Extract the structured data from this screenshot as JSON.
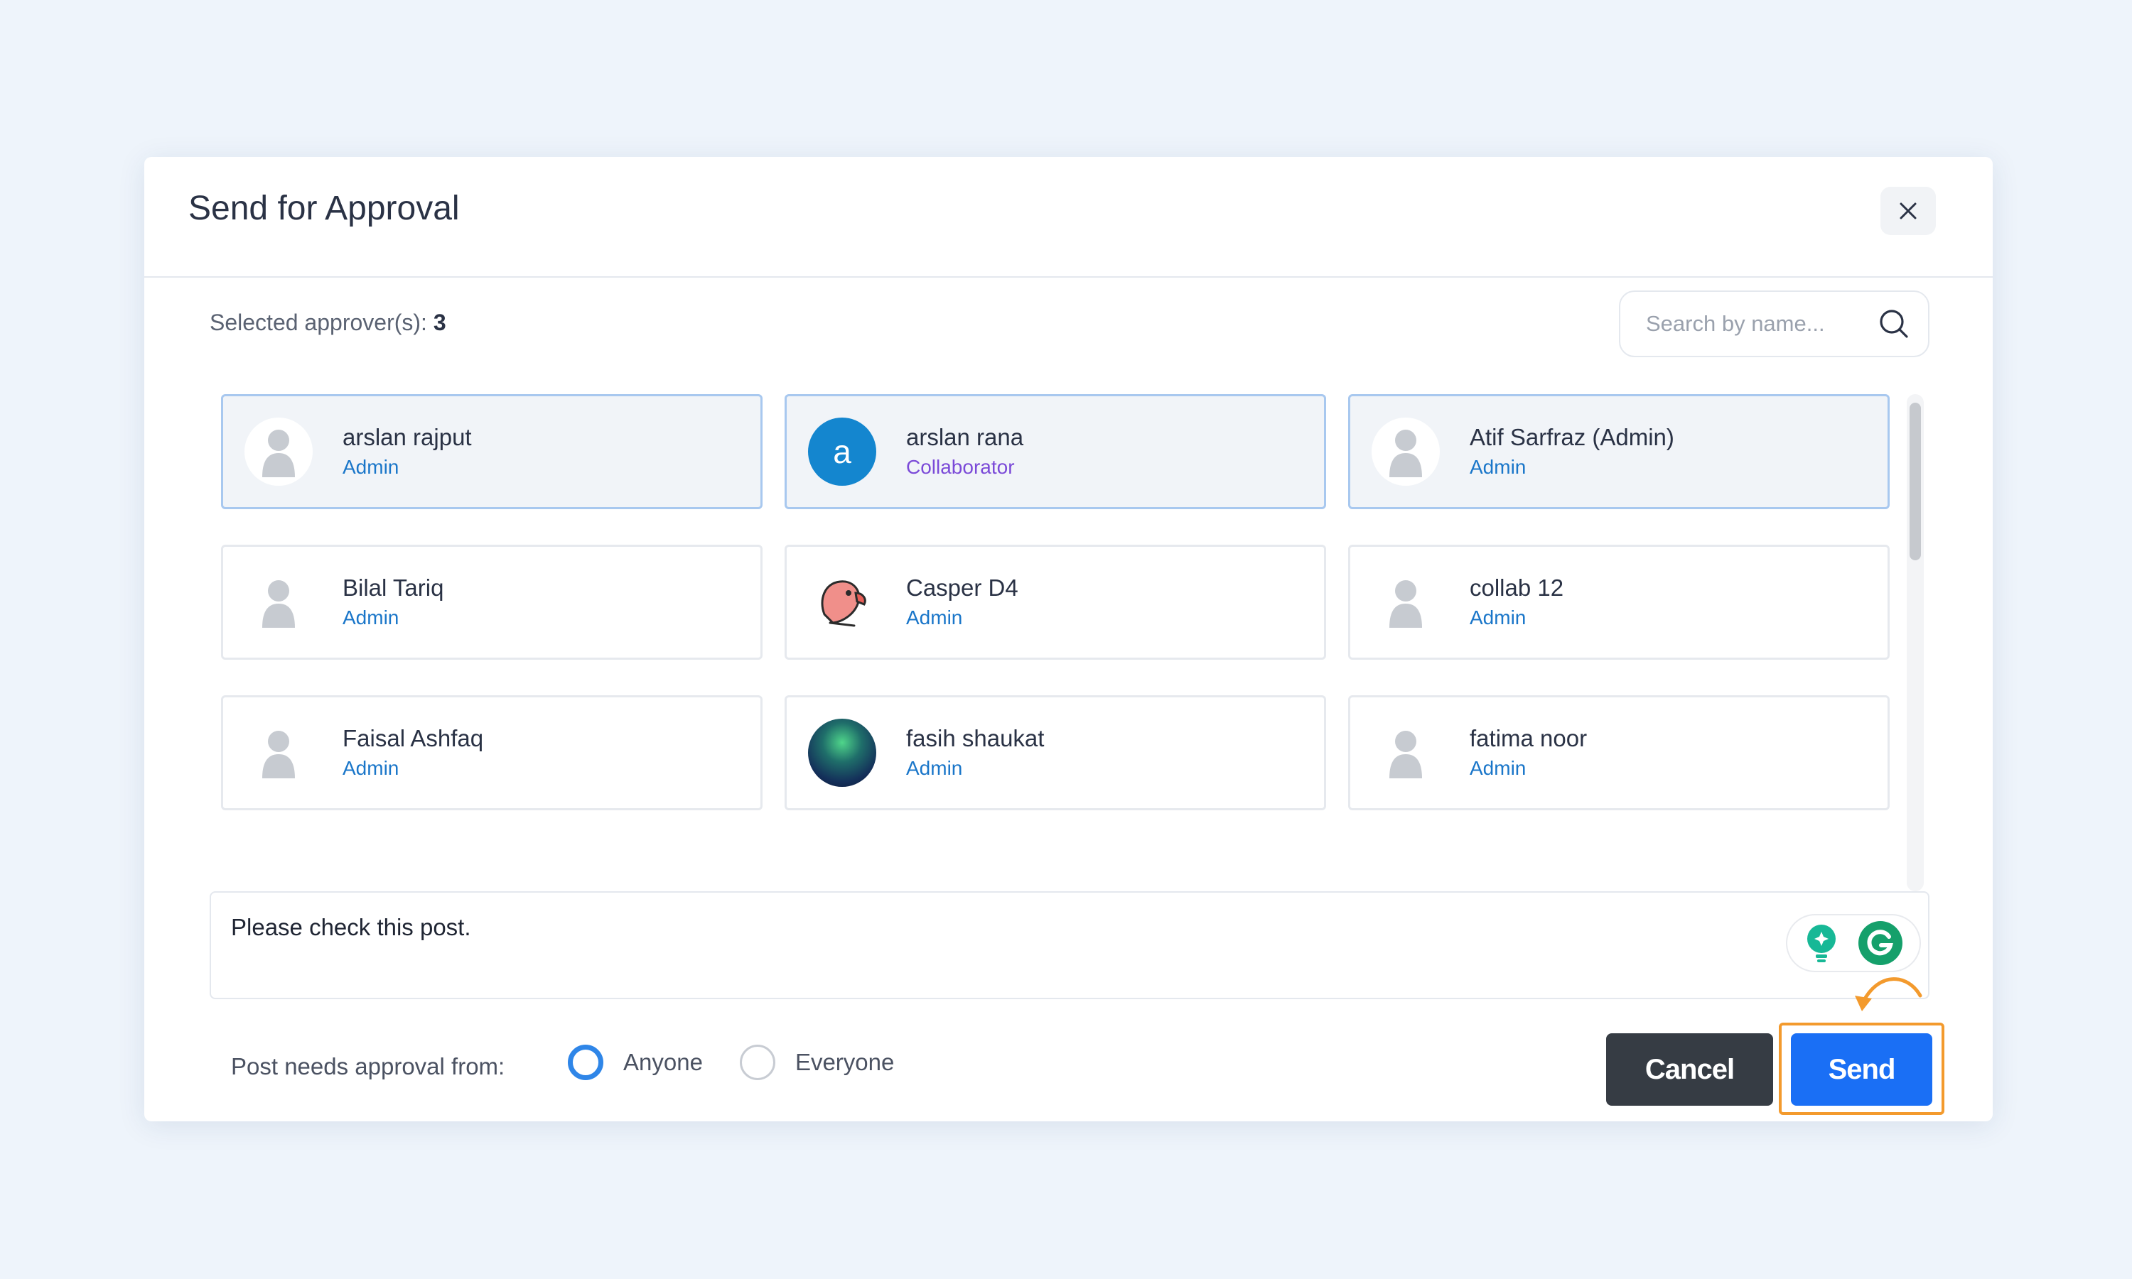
{
  "modal": {
    "title": "Send for Approval"
  },
  "selection": {
    "label": "Selected approver(s):",
    "count": "3"
  },
  "search": {
    "placeholder": "Search by name..."
  },
  "approvers": [
    {
      "name": "arslan rajput",
      "role": "Admin",
      "selected": true,
      "avatar": "default-user-icon"
    },
    {
      "name": "arslan rana",
      "role": "Collaborator",
      "selected": true,
      "avatar": "letter",
      "letter": "a"
    },
    {
      "name": "Atif Sarfraz (Admin)",
      "role": "Admin",
      "selected": true,
      "avatar": "default-user-icon"
    },
    {
      "name": "Bilal Tariq",
      "role": "Admin",
      "selected": false,
      "avatar": "default-user-icon"
    },
    {
      "name": "Casper D4",
      "role": "Admin",
      "selected": false,
      "avatar": "parrot-icon"
    },
    {
      "name": "collab 12",
      "role": "Admin",
      "selected": false,
      "avatar": "default-user-icon"
    },
    {
      "name": "Faisal Ashfaq",
      "role": "Admin",
      "selected": false,
      "avatar": "default-user-icon"
    },
    {
      "name": "fasih shaukat",
      "role": "Admin",
      "selected": false,
      "avatar": "aurora-photo"
    },
    {
      "name": "fatima noor",
      "role": "Admin",
      "selected": false,
      "avatar": "default-user-icon"
    }
  ],
  "message": {
    "value": "Please check this post."
  },
  "approval_mode": {
    "label": "Post needs approval from:",
    "options": [
      {
        "label": "Anyone",
        "checked": true
      },
      {
        "label": "Everyone",
        "checked": false
      }
    ]
  },
  "actions": {
    "cancel_label": "Cancel",
    "send_label": "Send"
  },
  "colors": {
    "primary": "#1a6ff5",
    "dark_button": "#363c44",
    "highlight": "#f39a2d",
    "role_admin": "#1a76c9",
    "role_collaborator": "#7b4ad8",
    "selected_border": "#a8c8ef"
  }
}
